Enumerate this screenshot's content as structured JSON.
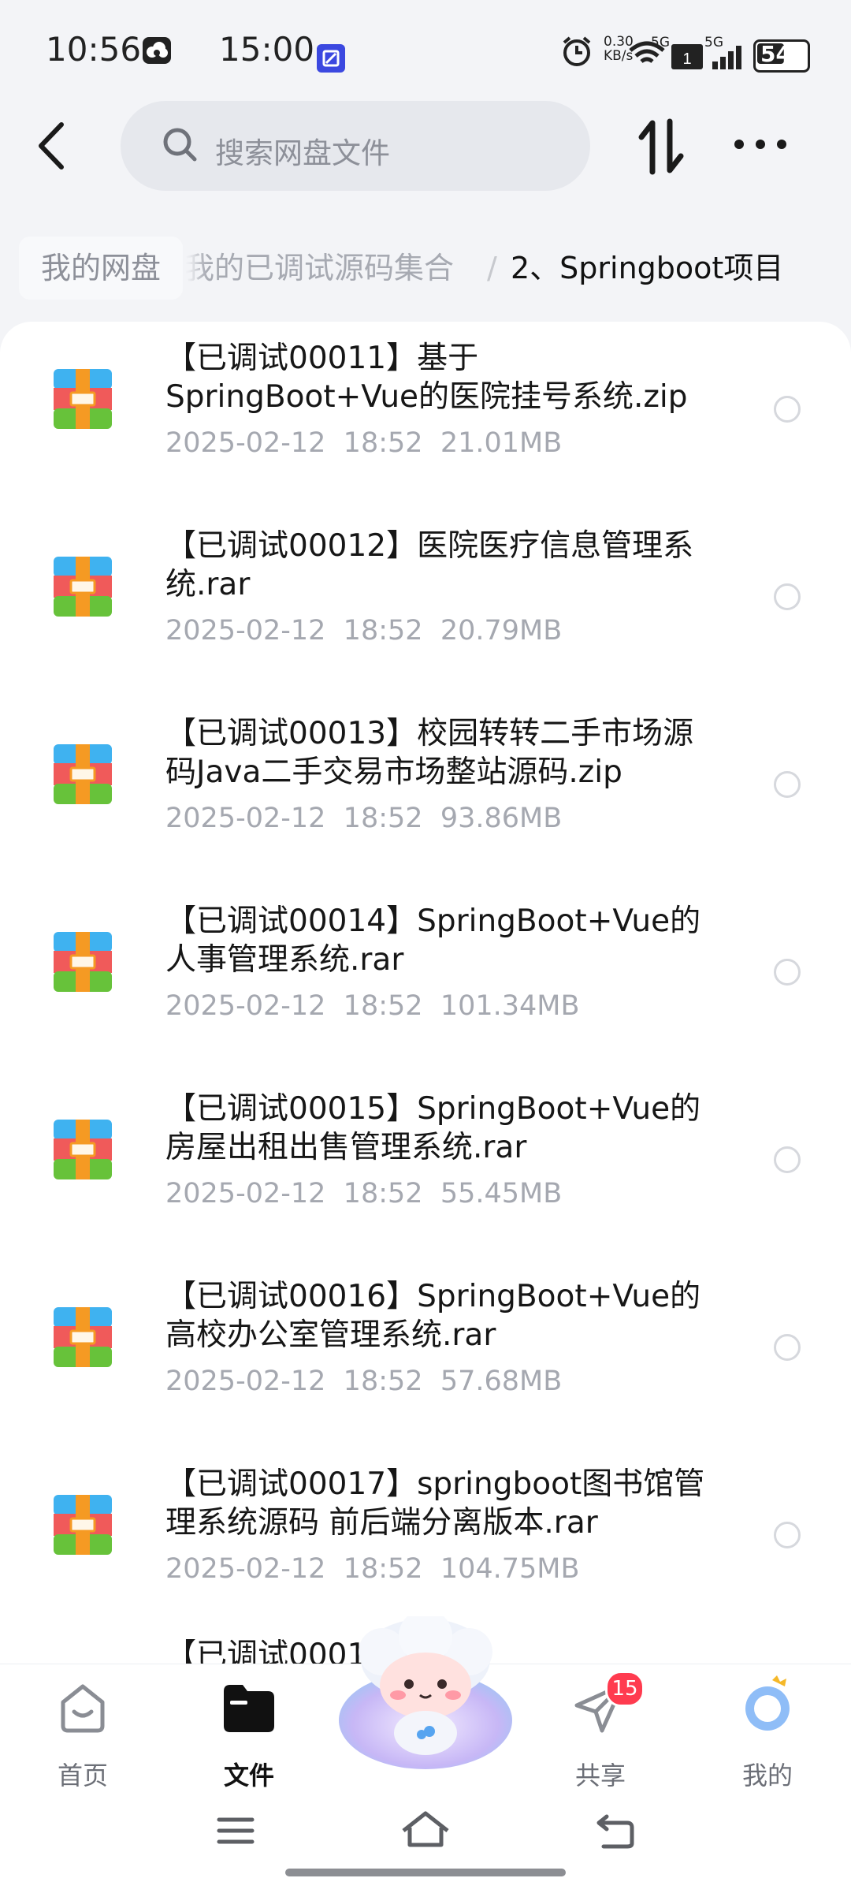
{
  "status_bar": {
    "time_primary": "10:56",
    "time_secondary": "15:00",
    "net_speed": "0.30\nKB/s",
    "net_speed_top": "0.30",
    "net_speed_unit": "KB/s",
    "signal_1": "5G",
    "signal_2": "5G",
    "battery": "54"
  },
  "toolbar": {
    "search_placeholder": "搜索网盘文件"
  },
  "breadcrumb": {
    "root": "我的网盘",
    "middle": "我的已调试源码集合",
    "separator": "/",
    "current": "2、Springboot项目"
  },
  "files": [
    {
      "name": "【已调试00011】基于SpringBoot+Vue的医院挂号系统.zip",
      "line1": "【已调试00011】基于",
      "line2": "SpringBoot+Vue的医院挂号系统.zip",
      "date": "2025-02-12",
      "time": "18:52",
      "size": "21.01MB"
    },
    {
      "name": "【已调试00012】医院医疗信息管理系统.rar",
      "line1": "【已调试00012】医院医疗信息管理系",
      "line2": "统.rar",
      "date": "2025-02-12",
      "time": "18:52",
      "size": "20.79MB"
    },
    {
      "name": "【已调试00013】校园转转二手市场源码Java二手交易市场整站源码.zip",
      "line1": "【已调试00013】校园转转二手市场源",
      "line2": "码Java二手交易市场整站源码.zip",
      "date": "2025-02-12",
      "time": "18:52",
      "size": "93.86MB"
    },
    {
      "name": "【已调试00014】SpringBoot+Vue的人事管理系统.rar",
      "line1": "【已调试00014】SpringBoot+Vue的",
      "line2": "人事管理系统.rar",
      "date": "2025-02-12",
      "time": "18:52",
      "size": "101.34MB"
    },
    {
      "name": "【已调试00015】SpringBoot+Vue的房屋出租出售管理系统.rar",
      "line1": "【已调试00015】SpringBoot+Vue的",
      "line2": "房屋出租出售管理系统.rar",
      "date": "2025-02-12",
      "time": "18:52",
      "size": "55.45MB"
    },
    {
      "name": "【已调试00016】SpringBoot+Vue的高校办公室管理系统.rar",
      "line1": "【已调试00016】SpringBoot+Vue的",
      "line2": "高校办公室管理系统.rar",
      "date": "2025-02-12",
      "time": "18:52",
      "size": "57.68MB"
    },
    {
      "name": "【已调试00017】springboot图书馆管理系统源码 前后端分离版本.rar",
      "line1": "【已调试00017】springboot图书馆管",
      "line2": "理系统源码 前后端分离版本.rar",
      "date": "2025-02-12",
      "time": "18:52",
      "size": "104.75MB"
    }
  ],
  "partial_row_text": "【已调试0001",
  "nav": {
    "home": "首页",
    "files": "文件",
    "share": "共享",
    "share_badge": "15",
    "me": "我的"
  },
  "colors": {
    "accent": "#3b6cf6",
    "badge": "#ff3b4f",
    "archive_top": "#3fb2f0",
    "archive_mid": "#f05a5a",
    "archive_bottom": "#67c23a",
    "archive_strap": "#f59a23"
  },
  "icons": [
    "cloud-app-icon",
    "remote-app-icon",
    "alarm-icon",
    "wifi-icon",
    "signal-icon",
    "battery-icon",
    "back-icon",
    "search-icon",
    "sort-icon",
    "more-icon",
    "archive-file-icon",
    "home-icon",
    "folder-icon",
    "mascot-icon",
    "share-icon",
    "profile-icon"
  ]
}
